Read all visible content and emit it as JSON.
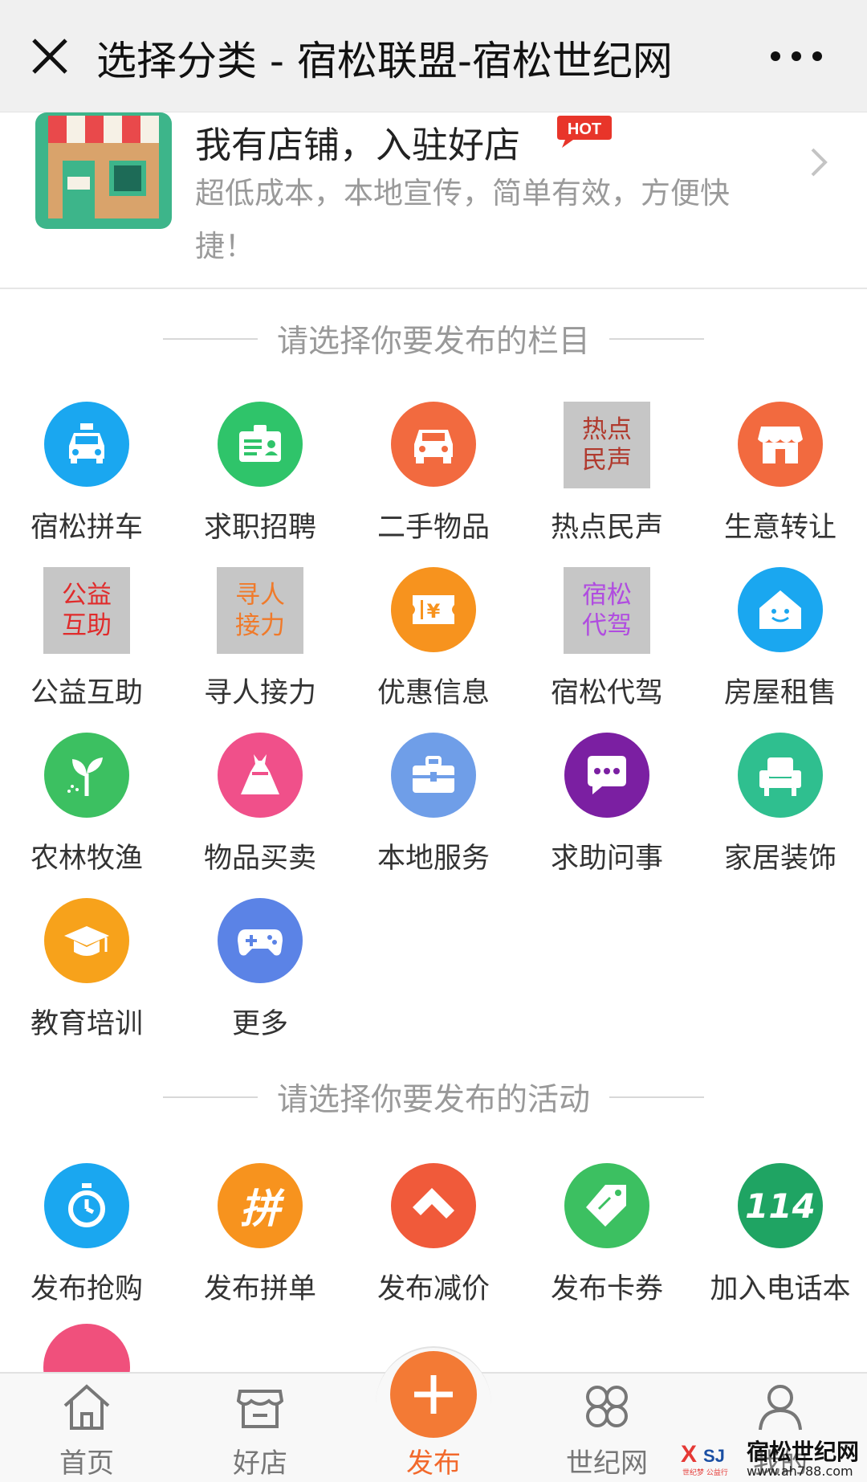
{
  "header": {
    "title": "选择分类 - 宿松联盟-宿松世纪网",
    "close_icon": "close-icon",
    "more_icon": "more-dots-icon"
  },
  "shop_banner": {
    "title": "我有店铺，入驻好店",
    "hot_badge": "HOT",
    "description": "超低成本，本地宣传，简单有效，方便快捷！"
  },
  "sections": {
    "columns_title": "请选择你要发布的栏目",
    "activities_title": "请选择你要发布的活动"
  },
  "columns": [
    {
      "label": "宿松拼车",
      "icon": "taxi-icon",
      "color": "#1aa7f0"
    },
    {
      "label": "求职招聘",
      "icon": "id-card-icon",
      "color": "#2fc46a"
    },
    {
      "label": "二手物品",
      "icon": "car-icon",
      "color": "#f26a3f"
    },
    {
      "label": "热点民声",
      "tile_text": [
        "热点",
        "民声"
      ],
      "tile_color": "#b03a2e"
    },
    {
      "label": "生意转让",
      "icon": "store-icon",
      "color": "#f26a3f"
    },
    {
      "label": "公益互助",
      "tile_text": [
        "公益",
        "互助"
      ],
      "tile_color": "#e02b2b"
    },
    {
      "label": "寻人接力",
      "tile_text": [
        "寻人",
        "接力"
      ],
      "tile_color": "#f07a2a"
    },
    {
      "label": "优惠信息",
      "icon": "ticket-icon",
      "color": "#f7931e"
    },
    {
      "label": "宿松代驾",
      "tile_text": [
        "宿松",
        "代驾"
      ],
      "tile_color": "#b04ce0"
    },
    {
      "label": "房屋租售",
      "icon": "house-icon",
      "color": "#1aa7f0"
    },
    {
      "label": "农林牧渔",
      "icon": "sprout-icon",
      "color": "#3cc061"
    },
    {
      "label": "物品买卖",
      "icon": "dress-icon",
      "color": "#f0508a"
    },
    {
      "label": "本地服务",
      "icon": "toolbox-icon",
      "color": "#6f9ee8"
    },
    {
      "label": "求助问事",
      "icon": "chat-bubble-icon",
      "color": "#7b1fa2"
    },
    {
      "label": "家居装饰",
      "icon": "armchair-icon",
      "color": "#2fbf8f"
    },
    {
      "label": "教育培训",
      "icon": "graduation-cap-icon",
      "color": "#f7a21b"
    },
    {
      "label": "更多",
      "icon": "gamepad-icon",
      "color": "#5b83e6"
    }
  ],
  "activities": [
    {
      "label": "发布抢购",
      "icon": "stopwatch-icon",
      "color": "#1aa7f0"
    },
    {
      "label": "发布拼单",
      "icon": "pin-character-icon",
      "color": "#f7931e",
      "glyph": "拼"
    },
    {
      "label": "发布减价",
      "icon": "discount-arrow-icon",
      "color": "#f05a3a"
    },
    {
      "label": "发布卡券",
      "icon": "coupon-tag-icon",
      "color": "#3cc061"
    },
    {
      "label": "加入电话本",
      "icon": "phonebook-114-icon",
      "color": "#1fa463",
      "glyph": "114"
    }
  ],
  "tabbar": {
    "tabs": [
      {
        "label": "首页",
        "icon": "home-icon"
      },
      {
        "label": "好店",
        "icon": "shop-icon"
      },
      {
        "label": "发布",
        "icon": "plus-icon",
        "active": true
      },
      {
        "label": "世纪网",
        "icon": "clover-icon"
      },
      {
        "label": "我的",
        "icon": "user-icon"
      }
    ],
    "accent_color": "#f37a35"
  },
  "watermark": {
    "name": "宿松世纪网",
    "url": "www.ah788.com",
    "logo_text": "SJ",
    "logo_subtext": "世纪梦  公益行"
  }
}
